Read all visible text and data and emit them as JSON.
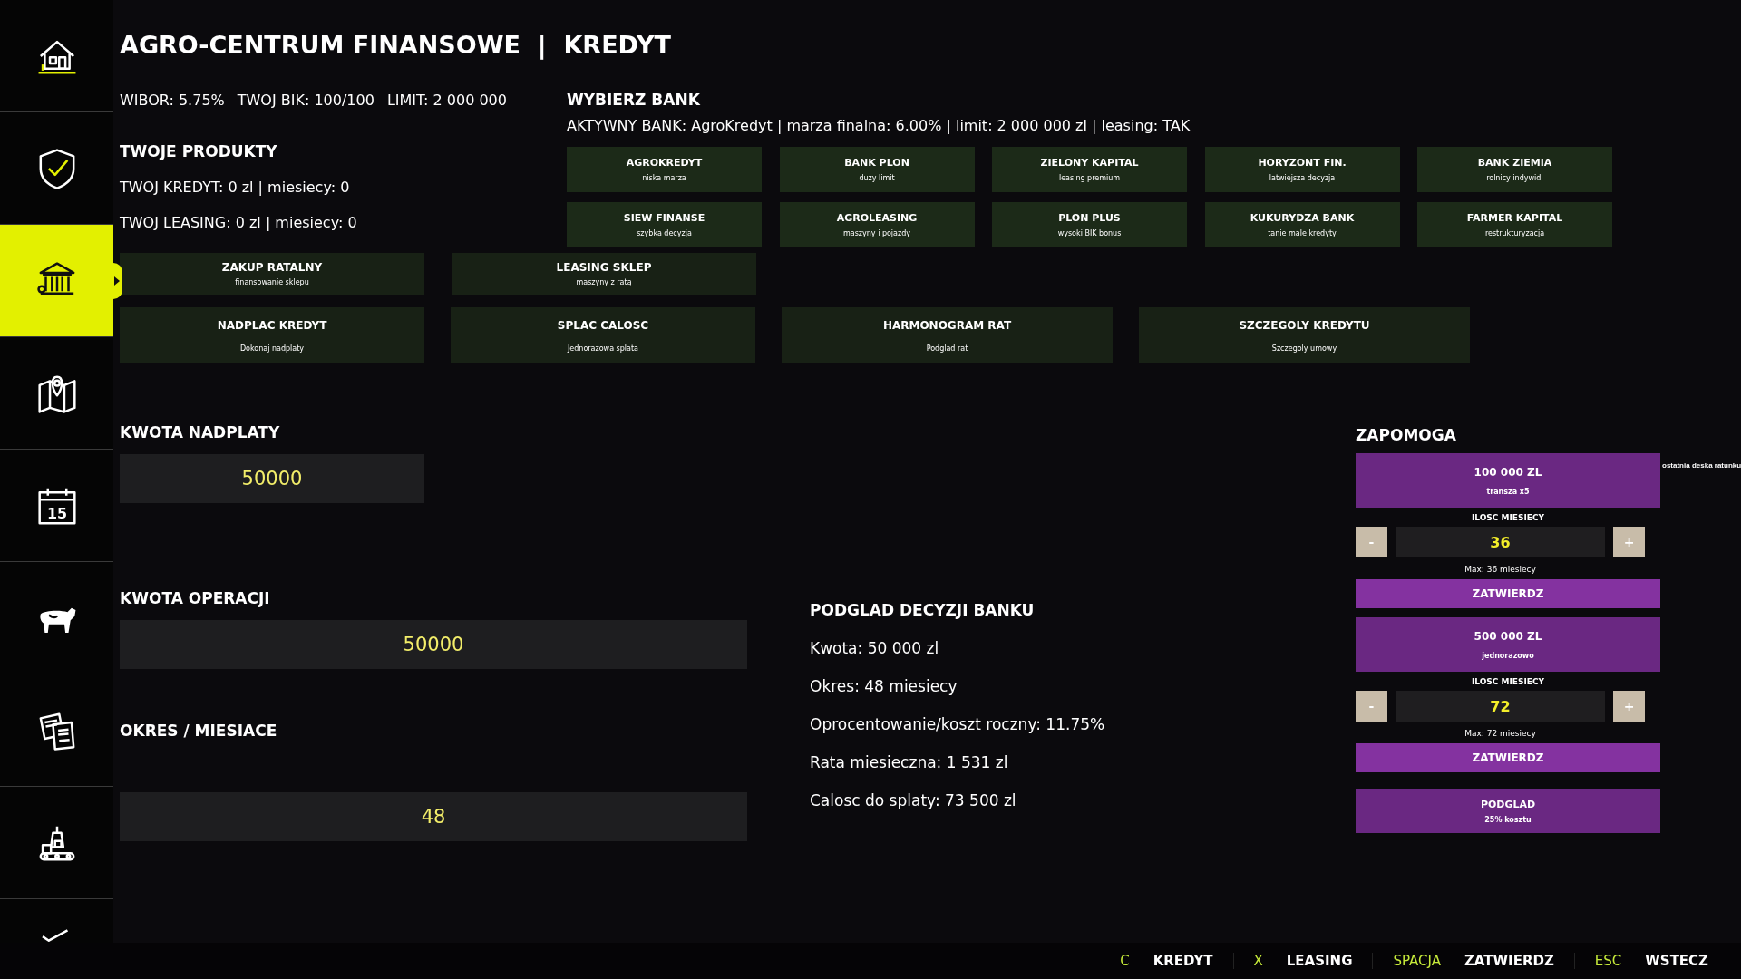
{
  "sidebar": {
    "items": [
      {
        "kind": "house",
        "selected": false
      },
      {
        "kind": "shield",
        "selected": false
      },
      {
        "kind": "bank",
        "selected": true
      },
      {
        "kind": "map",
        "selected": false
      },
      {
        "kind": "calendar",
        "selected": false,
        "icon_text": "15"
      },
      {
        "kind": "cow",
        "selected": false
      },
      {
        "kind": "documents",
        "selected": false
      },
      {
        "kind": "factory",
        "selected": false
      },
      {
        "kind": "check",
        "selected": false
      }
    ]
  },
  "header": {
    "title": "AGRO-CENTRUM FINANSOWE  |  KREDYT",
    "stats": [
      "WIBOR: 5.75%",
      "TWOJ BIK: 100/100",
      "LIMIT: 2 000 000"
    ]
  },
  "products": {
    "heading": "TWOJE PRODUKTY",
    "lines": [
      "TWOJ KREDYT: 0 zl | miesiecy: 0",
      "TWOJ LEASING: 0 zl | miesiecy: 0"
    ]
  },
  "bank_picker": {
    "heading": "WYBIERZ BANK",
    "active_line": "AKTYWNY BANK: AgroKredyt | marza finalna: 6.00% | limit: 2 000 000 zl | leasing: TAK",
    "banks": [
      {
        "name": "AGROKREDYT",
        "note": "niska marza"
      },
      {
        "name": "BANK PLON",
        "note": "duzy limit"
      },
      {
        "name": "ZIELONY KAPITAL",
        "note": "leasing premium"
      },
      {
        "name": "HORYZONT FIN.",
        "note": "latwiejsza decyzja"
      },
      {
        "name": "BANK ZIEMIA",
        "note": "rolnicy indywid."
      },
      {
        "name": "SIEW FINANSE",
        "note": "szybka decyzja"
      },
      {
        "name": "AGROLEASING",
        "note": "maszyny i pojazdy"
      },
      {
        "name": "PLON PLUS",
        "note": "wysoki BIK bonus"
      },
      {
        "name": "KUKURYDZA BANK",
        "note": "tanie male kredyty"
      },
      {
        "name": "FARMER KAPITAL",
        "note": "restrukturyzacja"
      }
    ]
  },
  "actions": [
    [
      {
        "label": "ZAKUP RATALNY",
        "note": "finansowanie sklepu"
      },
      {
        "label": "LEASING SKLEP",
        "note": "maszyny z ratą"
      }
    ],
    [
      {
        "label": "NADPLAC KREDYT",
        "note": "Dokonaj nadplaty"
      },
      {
        "label": "SPLAC CALOSC",
        "note": "Jednorazowa splata"
      },
      {
        "label": "HARMONOGRAM RAT",
        "note": "Podglad rat"
      },
      {
        "label": "SZCZEGOLY KREDYTU",
        "note": "Szczegoly umowy"
      }
    ]
  ],
  "form": {
    "overpay_label": "KWOTA NADPLATY",
    "overpay_value": "50000",
    "amount_label": "KWOTA OPERACJI",
    "amount_value": "50000",
    "period_label": "OKRES / MIESIACE",
    "period_value": "48"
  },
  "preview": {
    "heading": "PODGLAD DECYZJI BANKU",
    "lines": [
      "Kwota: 50 000 zl",
      "Okres: 48 miesiecy",
      "Oprocentowanie/koszt roczny: 11.75%",
      "Rata miesieczna: 1 531 zl",
      "Calosc do splaty: 73 500 zl"
    ]
  },
  "aid": {
    "heading": "ZAPOMOGA",
    "note": "ostatnia deska ratunku",
    "options": [
      {
        "amount": "100 000 ZL",
        "note": "transza x5",
        "months_label": "ILOSC MIESIECY",
        "minus": "-",
        "months": "36",
        "plus": "+",
        "max": "Max: 36 miesiecy",
        "confirm": "ZATWIERDZ"
      },
      {
        "amount": "500 000 ZL",
        "note": "jednorazowo",
        "months_label": "ILOSC MIESIECY",
        "minus": "-",
        "months": "72",
        "plus": "+",
        "max": "Max: 72 miesiecy",
        "confirm": "ZATWIERDZ"
      }
    ],
    "preview": {
      "label": "PODGLAD",
      "note": "25% kosztu"
    }
  },
  "footer": {
    "hints": [
      {
        "key": "C",
        "action": "KREDYT"
      },
      {
        "key": "X",
        "action": "LEASING"
      },
      {
        "key": "SPACJA",
        "action": "ZATWIERDZ"
      },
      {
        "key": "ESC",
        "action": "WSTECZ"
      }
    ]
  }
}
